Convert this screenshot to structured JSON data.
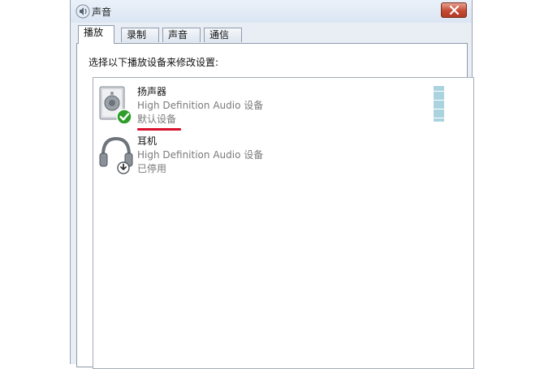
{
  "window": {
    "title": "声音",
    "icon": "speaker-icon",
    "close_icon": "close-icon"
  },
  "tabs": [
    {
      "label": "播放",
      "active": true
    },
    {
      "label": "录制",
      "active": false
    },
    {
      "label": "声音",
      "active": false
    },
    {
      "label": "通信",
      "active": false
    }
  ],
  "panel": {
    "instruction": "选择以下播放设备来修改设置:"
  },
  "devices": [
    {
      "name": "扬声器",
      "description": "High Definition Audio 设备",
      "status": "默认设备",
      "icon": "speaker-device-icon",
      "badge": "check-icon",
      "highlighted": true,
      "level_bars": 20
    },
    {
      "name": "耳机",
      "description": "High Definition Audio 设备",
      "status": "已停用",
      "icon": "headphones-device-icon",
      "badge": "disabled-down-arrow-icon"
    }
  ],
  "colors": {
    "highlight_underline": "#d9102b",
    "meter": "#aad3df",
    "close_button": "#c44a33"
  }
}
